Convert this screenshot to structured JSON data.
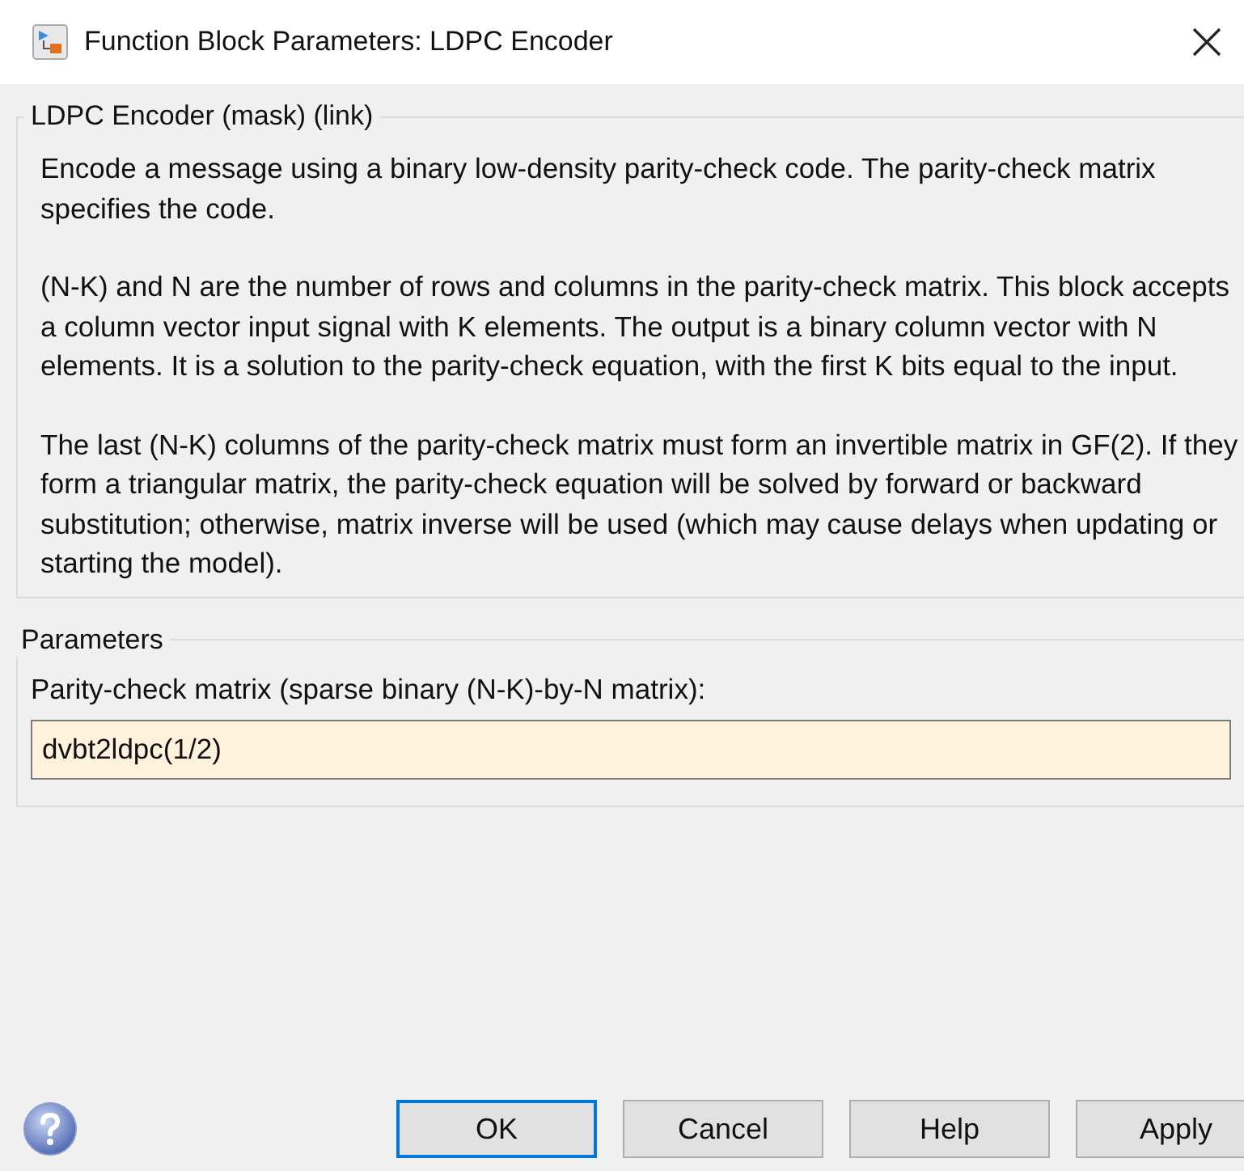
{
  "window": {
    "title": "Function Block Parameters: LDPC Encoder"
  },
  "description": {
    "title": "LDPC Encoder (mask) (link)",
    "paragraphs": [
      "Encode a message using a binary low-density parity-check code. The parity-check matrix specifies the code.",
      "(N-K) and N are the number of rows and columns in the parity-check matrix. This block accepts a column vector input signal with K elements. The output is a binary column vector with N elements. It is a solution to the parity-check equation, with the first K bits equal to the input.",
      "The last (N-K) columns of the parity-check matrix must form an invertible matrix in GF(2). If they form a triangular matrix, the parity-check equation will be solved by forward or backward substitution; otherwise, matrix inverse will be used (which may cause delays when updating or starting the model)."
    ]
  },
  "parameters": {
    "title": "Parameters",
    "label": "Parity-check matrix (sparse binary (N-K)-by-N matrix):",
    "value": "dvbt2ldpc(1/2)"
  },
  "buttons": [
    {
      "label": "OK",
      "focused": true
    },
    {
      "label": "Cancel",
      "focused": false
    },
    {
      "label": "Help",
      "focused": false
    },
    {
      "label": "Apply",
      "focused": false
    }
  ]
}
